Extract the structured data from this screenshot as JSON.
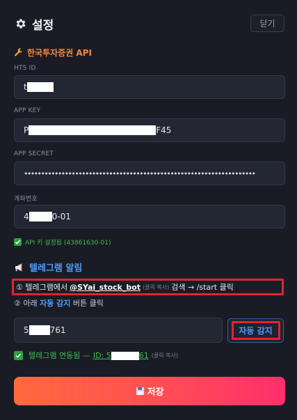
{
  "header": {
    "title": "설정",
    "close_label": "닫기"
  },
  "api_section": {
    "title": "한국투자증권 API",
    "hts_id": {
      "label": "HTS ID",
      "prefix": "t",
      "suffix": ""
    },
    "app_key": {
      "label": "APP KEY",
      "prefix": "P",
      "suffix": "F45"
    },
    "app_secret": {
      "label": "APP SECRET",
      "value": "••••••••••••••••••••••••••••••••••••••••••••••••••••••••••••••••••••"
    },
    "account": {
      "label": "계좌번호",
      "prefix": "4",
      "suffix": "0-01"
    },
    "status": "API 키 설정됨 (43861630-01)"
  },
  "telegram_section": {
    "title": "텔레그램 알림",
    "step1_prefix": "① 텔레그램에서",
    "bot_name": "@SYai_stock_bot",
    "click_copy_hint": "(클릭 복사)",
    "step1_suffix": "검색 → /start 클릭",
    "step2_prefix": "② 아래",
    "step2_accent": "자동 감지",
    "step2_suffix": "버튼 클릭",
    "chat_id": {
      "prefix": "5",
      "suffix": "761"
    },
    "auto_detect_label": "자동 감지",
    "linked_text": "텔레그램 연동됨 —",
    "linked_id_prefix": "ID: 5",
    "linked_id_suffix": "61",
    "linked_hint": "(클릭 복사)"
  },
  "save_label": "저장",
  "icons": {
    "header": "gear-icon",
    "api": "wrench-icon",
    "telegram": "megaphone-icon",
    "check": "checkbox-icon",
    "save": "floppy-disk-icon"
  },
  "colors": {
    "background": "#1a1c25",
    "api_accent": "#f0883e",
    "telegram_accent": "#4f9cf9",
    "success": "#3fb950",
    "highlight_box": "#e0242f",
    "save_gradient_start": "#ff6a3d",
    "save_gradient_end": "#ff2f6d"
  }
}
